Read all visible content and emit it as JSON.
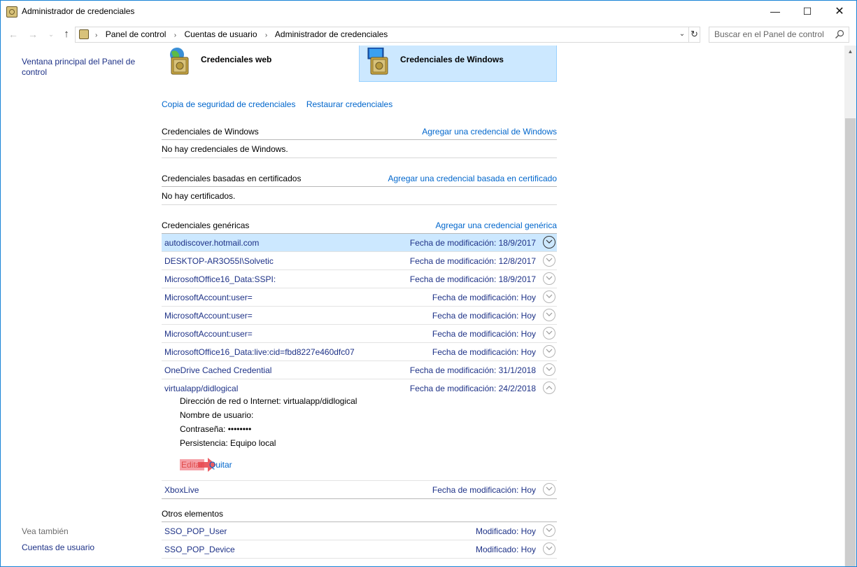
{
  "window": {
    "title": "Administrador de credenciales",
    "min_glyph": "—",
    "max_glyph": "☐",
    "close_glyph": "✕"
  },
  "nav": {
    "back": "←",
    "forward": "→",
    "recent": "⌄",
    "up": "↑"
  },
  "address": {
    "crumbs": [
      "Panel de control",
      "Cuentas de usuario",
      "Administrador de credenciales"
    ],
    "separator": "›",
    "dropdown": "⌄",
    "refresh": "↻"
  },
  "search": {
    "placeholder": "Buscar en el Panel de control"
  },
  "sidebar": {
    "home_link": "Ventana principal del Panel de control",
    "see_also": "Vea también",
    "user_accounts": "Cuentas de usuario"
  },
  "tiles": {
    "web": "Credenciales web",
    "windows": "Credenciales de Windows"
  },
  "backup": {
    "backup_link": "Copia de seguridad de credenciales",
    "restore_link": "Restaurar credenciales"
  },
  "windows_creds": {
    "title": "Credenciales de Windows",
    "add_link": "Agregar una credencial de Windows",
    "empty": "No hay credenciales de Windows."
  },
  "cert_creds": {
    "title": "Credenciales basadas en certificados",
    "add_link": "Agregar una credencial basada en certificado",
    "empty": "No hay certificados."
  },
  "generic_creds": {
    "title": "Credenciales genéricas",
    "add_link": "Agregar una credencial genérica",
    "rows": [
      {
        "name": "autodiscover.hotmail.com",
        "date": "Fecha de modificación:  18/9/2017"
      },
      {
        "name": "DESKTOP-AR3O55I\\Solvetic",
        "date": "Fecha de modificación:  12/8/2017"
      },
      {
        "name": "MicrosoftOffice16_Data:SSPI:",
        "date": "Fecha de modificación:  18/9/2017"
      },
      {
        "name": "MicrosoftAccount:user=",
        "date": "Fecha de modificación:  Hoy"
      },
      {
        "name": "MicrosoftAccount:user=",
        "date": "Fecha de modificación:  Hoy"
      },
      {
        "name": "MicrosoftAccount:user=",
        "date": "Fecha de modificación:  Hoy"
      },
      {
        "name": "MicrosoftOffice16_Data:live:cid=fbd8227e460dfc07",
        "date": "Fecha de modificación:  Hoy"
      },
      {
        "name": "OneDrive Cached Credential",
        "date": "Fecha de modificación:  31/1/2018"
      },
      {
        "name": "virtualapp/didlogical",
        "date": "Fecha de modificación:  24/2/2018"
      }
    ],
    "expanded": {
      "address": "Dirección de red o Internet:  virtualapp/didlogical",
      "username": "Nombre de usuario:",
      "password": "Contraseña:  ••••••••",
      "persistence": "Persistencia:  Equipo local",
      "edit": "Editar",
      "remove": "Quitar"
    },
    "last_row": {
      "name": "XboxLive",
      "date": "Fecha de modificación:  Hoy"
    }
  },
  "other": {
    "title": "Otros elementos",
    "rows": [
      {
        "name": "SSO_POP_User",
        "date": "Modificado:  Hoy"
      },
      {
        "name": "SSO_POP_Device",
        "date": "Modificado:  Hoy"
      }
    ]
  },
  "colors": {
    "link": "#0066cc",
    "item_text": "#1e3287",
    "selection": "#cce8ff",
    "edit_highlight": "#f59fa6",
    "arrow": "#e84a52"
  }
}
